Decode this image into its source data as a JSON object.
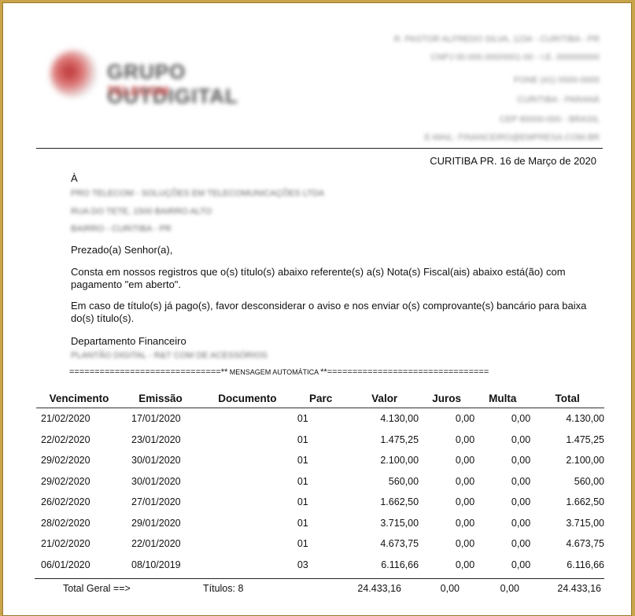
{
  "header": {
    "company_name": "GRUPO OUTDIGITAL",
    "company_tagline": "TELECOM",
    "contact_lines": [
      "R. PASTOR ALFREDO SILVA, 1234 - CURITIBA - PR",
      "CNPJ 00.000.000/0001-00 - I.E. 000000000",
      "FONE (41) 0000-0000",
      "CURITIBA - PARANÁ",
      "CEP 80000-000 - BRASIL",
      "E-MAIL: FINANCEIRO@EMPRESA.COM.BR"
    ]
  },
  "letter": {
    "date_line": "CURITIBA PR. 16 de Março de 2020",
    "to_label": "À",
    "recipient_lines": [
      "PRO TELECOM - SOLUÇÕES EM TELECOMUNICAÇÕES LTDA",
      "RUA DO TETE, 1500 BAIRRO ALTO",
      "BAIRRO - CURITIBA - PR"
    ],
    "greeting": "Prezado(a) Senhor(a),",
    "paragraph1": " Consta em nossos registros que o(s) título(s) abaixo referente(s) a(s) Nota(s) Fiscal(ais) abaixo está(ão) com pagamento \"em aberto\".",
    "paragraph2": "Em caso de título(s) já pago(s), favor desconsiderar o aviso e nos enviar o(s) comprovante(s) bancário para baixa do(s) título(s).",
    "department": "Departamento Financeiro",
    "department_sub": "PLANTÃO DIGITAL - R&T COM DE ACESSÓRIOS",
    "separator_left": "==============================**",
    "separator_mid": " MENSAGEM AUTOMÁTICA ",
    "separator_right": "**================================"
  },
  "table": {
    "headers": [
      "Vencimento",
      "Emissão",
      "Documento",
      "Parc",
      "Valor",
      "Juros",
      "Multa",
      "Total"
    ],
    "rows": [
      [
        "21/02/2020",
        "17/01/2020",
        "",
        "01",
        "4.130,00",
        "0,00",
        "0,00",
        "4.130,00"
      ],
      [
        "22/02/2020",
        "23/01/2020",
        "",
        "01",
        "1.475,25",
        "0,00",
        "0,00",
        "1.475,25"
      ],
      [
        "29/02/2020",
        "30/01/2020",
        "",
        "01",
        "2.100,00",
        "0,00",
        "0,00",
        "2.100,00"
      ],
      [
        "29/02/2020",
        "30/01/2020",
        "",
        "01",
        "560,00",
        "0,00",
        "0,00",
        "560,00"
      ],
      [
        "26/02/2020",
        "27/01/2020",
        "",
        "01",
        "1.662,50",
        "0,00",
        "0,00",
        "1.662,50"
      ],
      [
        "28/02/2020",
        "29/01/2020",
        "",
        "01",
        "3.715,00",
        "0,00",
        "0,00",
        "3.715,00"
      ],
      [
        "21/02/2020",
        "22/01/2020",
        "",
        "01",
        "4.673,75",
        "0,00",
        "0,00",
        "4.673,75"
      ],
      [
        "06/01/2020",
        "08/10/2019",
        "",
        "03",
        "6.116,66",
        "0,00",
        "0,00",
        "6.116,66"
      ]
    ],
    "totals": {
      "label": "Total Geral ==>",
      "count_label": "Títulos: 8",
      "valor": "24.433,16",
      "juros": "0,00",
      "multa": "0,00",
      "total": "24.433,16"
    }
  }
}
